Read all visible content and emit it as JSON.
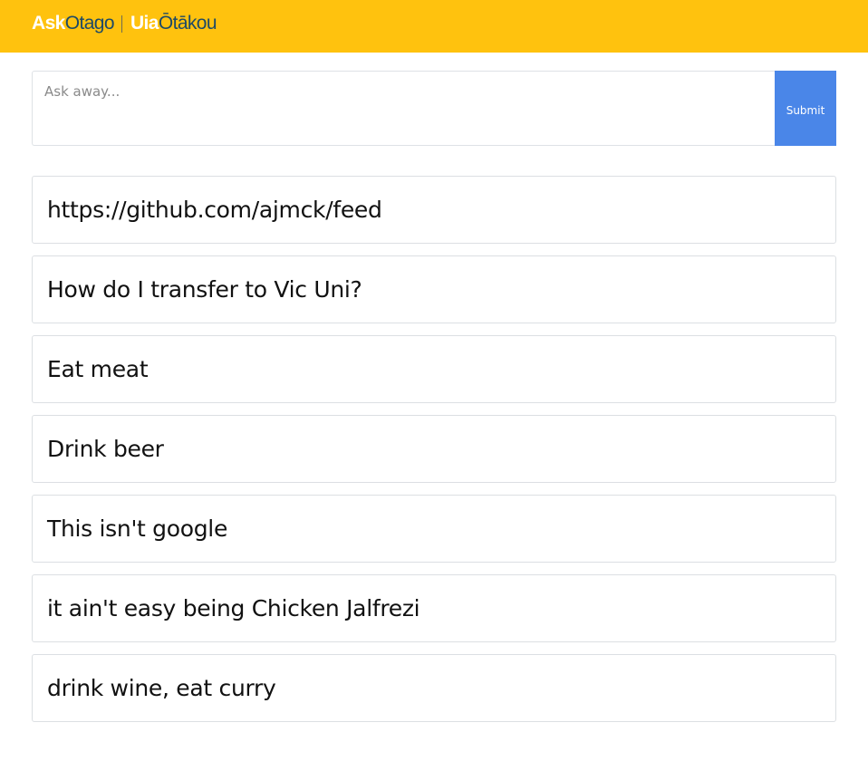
{
  "header": {
    "logo_part1_bold": "Ask",
    "logo_part1_light": "Otago",
    "logo_part2_bold": "Uia",
    "logo_part2_light": "Ōtākou",
    "background_color": "#ffc20e"
  },
  "ask": {
    "placeholder": "Ask away...",
    "value": "",
    "submit_label": "Submit",
    "submit_color": "#4a86e8"
  },
  "questions": [
    {
      "text": "https://github.com/ajmck/feed"
    },
    {
      "text": "How do I transfer to Vic Uni?"
    },
    {
      "text": "Eat meat"
    },
    {
      "text": "Drink beer"
    },
    {
      "text": "This isn't google"
    },
    {
      "text": "it ain't easy being Chicken Jalfrezi"
    },
    {
      "text": "drink wine, eat curry"
    }
  ]
}
